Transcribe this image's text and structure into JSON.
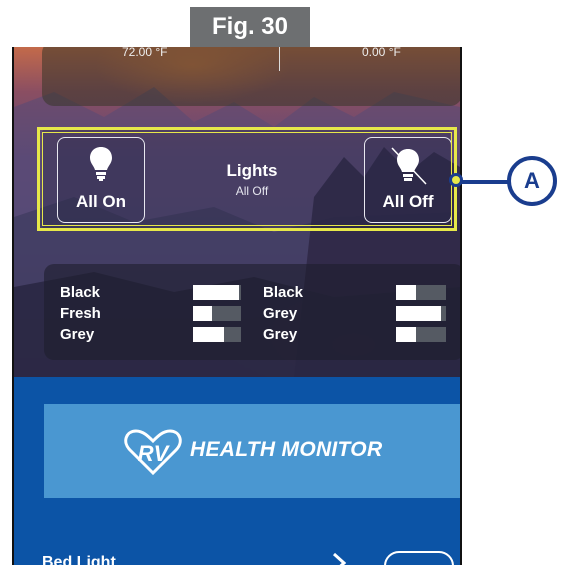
{
  "figure": {
    "label": "Fig. 30"
  },
  "temperatures": {
    "left": "72.00 °F",
    "right": "0.00 °F"
  },
  "lights": {
    "title": "Lights",
    "status": "All Off",
    "on_label": "All On",
    "off_label": "All Off"
  },
  "callout": {
    "letter": "A"
  },
  "tanks": {
    "left": [
      {
        "name": "Black",
        "level": 0.95
      },
      {
        "name": "Fresh",
        "level": 0.4
      },
      {
        "name": "Grey",
        "level": 0.65
      }
    ],
    "right": [
      {
        "name": "Black",
        "level": 0.4
      },
      {
        "name": "Grey",
        "level": 0.9
      },
      {
        "name": "Grey",
        "level": 0.4
      }
    ]
  },
  "health_monitor": {
    "text": "HEALTH MONITOR",
    "logo": "RV"
  },
  "bed_light": {
    "label": "Bed Light",
    "state": "off"
  },
  "colors": {
    "highlight": "#e7e84a",
    "callout": "#1a3d8e",
    "blue_area": "#0c54a6",
    "health_panel": "#4a97d1"
  }
}
